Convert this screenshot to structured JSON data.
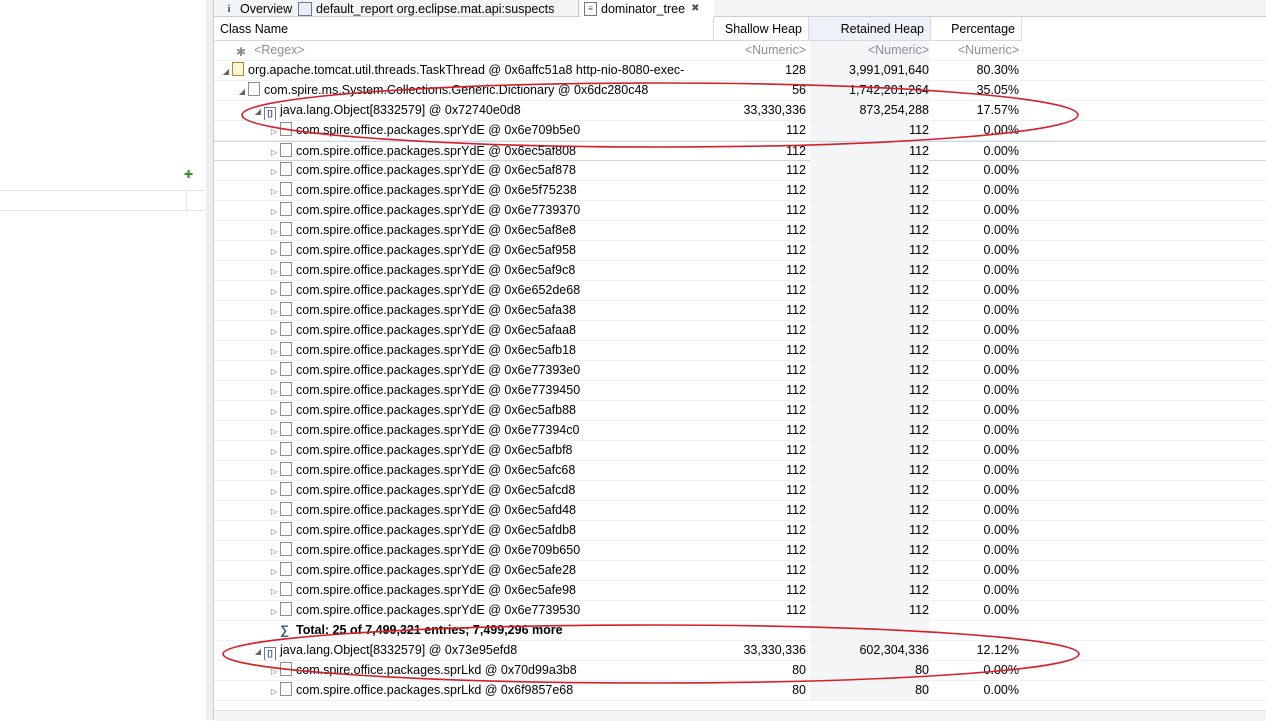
{
  "tabs": [
    {
      "label": "Overview",
      "icon": "info-icon"
    },
    {
      "label": "default_report  org.eclipse.mat.api:suspects",
      "icon": "report-icon"
    },
    {
      "label": "dominator_tree",
      "icon": "tree-icon",
      "active": true
    }
  ],
  "columns": {
    "class_name": "Class Name",
    "shallow_heap": "Shallow Heap",
    "retained_heap": "Retained Heap",
    "percentage": "Percentage"
  },
  "filter": {
    "class_name": "<Regex>",
    "shallow_heap": "<Numeric>",
    "retained_heap": "<Numeric>",
    "percentage": "<Numeric>"
  },
  "rows": [
    {
      "name": "org.apache.tomcat.util.threads.TaskThread @ 0x6affc51a8  http-nio-8080-exec-",
      "shallow": "128",
      "retained": "3,991,091,640",
      "pct": "80.30%"
    },
    {
      "name": "com.spire.ms.System.Collections.Generic.Dictionary @ 0x6dc280c48",
      "shallow": "56",
      "retained": "1,742,201,264",
      "pct": "35.05%"
    },
    {
      "name": "java.lang.Object[8332579] @ 0x72740e0d8",
      "shallow": "33,330,336",
      "retained": "873,254,288",
      "pct": "17.57%"
    },
    {
      "name": "com.spire.office.packages.sprYdE @ 0x6e709b5e0",
      "shallow": "112",
      "retained": "112",
      "pct": "0.00%"
    },
    {
      "name": "com.spire.office.packages.sprYdE @ 0x6ec5af808",
      "shallow": "112",
      "retained": "112",
      "pct": "0.00%"
    },
    {
      "name": "com.spire.office.packages.sprYdE @ 0x6ec5af878",
      "shallow": "112",
      "retained": "112",
      "pct": "0.00%"
    },
    {
      "name": "com.spire.office.packages.sprYdE @ 0x6e5f75238",
      "shallow": "112",
      "retained": "112",
      "pct": "0.00%"
    },
    {
      "name": "com.spire.office.packages.sprYdE @ 0x6e7739370",
      "shallow": "112",
      "retained": "112",
      "pct": "0.00%"
    },
    {
      "name": "com.spire.office.packages.sprYdE @ 0x6ec5af8e8",
      "shallow": "112",
      "retained": "112",
      "pct": "0.00%"
    },
    {
      "name": "com.spire.office.packages.sprYdE @ 0x6ec5af958",
      "shallow": "112",
      "retained": "112",
      "pct": "0.00%"
    },
    {
      "name": "com.spire.office.packages.sprYdE @ 0x6ec5af9c8",
      "shallow": "112",
      "retained": "112",
      "pct": "0.00%"
    },
    {
      "name": "com.spire.office.packages.sprYdE @ 0x6e652de68",
      "shallow": "112",
      "retained": "112",
      "pct": "0.00%"
    },
    {
      "name": "com.spire.office.packages.sprYdE @ 0x6ec5afa38",
      "shallow": "112",
      "retained": "112",
      "pct": "0.00%"
    },
    {
      "name": "com.spire.office.packages.sprYdE @ 0x6ec5afaa8",
      "shallow": "112",
      "retained": "112",
      "pct": "0.00%"
    },
    {
      "name": "com.spire.office.packages.sprYdE @ 0x6ec5afb18",
      "shallow": "112",
      "retained": "112",
      "pct": "0.00%"
    },
    {
      "name": "com.spire.office.packages.sprYdE @ 0x6e77393e0",
      "shallow": "112",
      "retained": "112",
      "pct": "0.00%"
    },
    {
      "name": "com.spire.office.packages.sprYdE @ 0x6e7739450",
      "shallow": "112",
      "retained": "112",
      "pct": "0.00%"
    },
    {
      "name": "com.spire.office.packages.sprYdE @ 0x6ec5afb88",
      "shallow": "112",
      "retained": "112",
      "pct": "0.00%"
    },
    {
      "name": "com.spire.office.packages.sprYdE @ 0x6e77394c0",
      "shallow": "112",
      "retained": "112",
      "pct": "0.00%"
    },
    {
      "name": "com.spire.office.packages.sprYdE @ 0x6ec5afbf8",
      "shallow": "112",
      "retained": "112",
      "pct": "0.00%"
    },
    {
      "name": "com.spire.office.packages.sprYdE @ 0x6ec5afc68",
      "shallow": "112",
      "retained": "112",
      "pct": "0.00%"
    },
    {
      "name": "com.spire.office.packages.sprYdE @ 0x6ec5afcd8",
      "shallow": "112",
      "retained": "112",
      "pct": "0.00%"
    },
    {
      "name": "com.spire.office.packages.sprYdE @ 0x6ec5afd48",
      "shallow": "112",
      "retained": "112",
      "pct": "0.00%"
    },
    {
      "name": "com.spire.office.packages.sprYdE @ 0x6ec5afdb8",
      "shallow": "112",
      "retained": "112",
      "pct": "0.00%"
    },
    {
      "name": "com.spire.office.packages.sprYdE @ 0x6e709b650",
      "shallow": "112",
      "retained": "112",
      "pct": "0.00%"
    },
    {
      "name": "com.spire.office.packages.sprYdE @ 0x6ec5afe28",
      "shallow": "112",
      "retained": "112",
      "pct": "0.00%"
    },
    {
      "name": "com.spire.office.packages.sprYdE @ 0x6ec5afe98",
      "shallow": "112",
      "retained": "112",
      "pct": "0.00%"
    },
    {
      "name": "com.spire.office.packages.sprYdE @ 0x6e7739530",
      "shallow": "112",
      "retained": "112",
      "pct": "0.00%"
    },
    {
      "name": "Total: 25 of 7,499,321 entries; 7,499,296 more",
      "shallow": "",
      "retained": "",
      "pct": ""
    },
    {
      "name": "java.lang.Object[8332579] @ 0x73e95efd8",
      "shallow": "33,330,336",
      "retained": "602,304,336",
      "pct": "12.12%"
    },
    {
      "name": "com.spire.office.packages.sprLkd @ 0x70d99a3b8",
      "shallow": "80",
      "retained": "80",
      "pct": "0.00%"
    },
    {
      "name": "com.spire.office.packages.sprLkd @ 0x6f9857e68",
      "shallow": "80",
      "retained": "80",
      "pct": "0.00%"
    }
  ],
  "annotation_color": "#d4202a"
}
